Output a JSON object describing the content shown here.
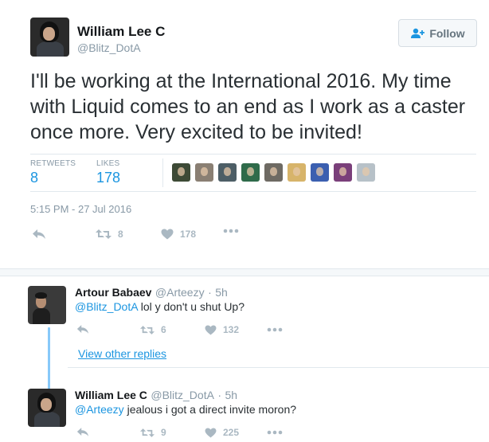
{
  "main_tweet": {
    "author_name": "William Lee C",
    "author_handle": "@Blitz_DotA",
    "follow_label": "Follow",
    "text": "I'll be working at the International 2016. My time with Liquid comes to an end as I work as a caster once more. Very excited to be invited!",
    "retweets_label": "RETWEETS",
    "retweets_count": "8",
    "likes_label": "LIKES",
    "likes_count": "178",
    "timestamp": "5:15 PM - 27 Jul 2016",
    "actions": {
      "retweet_count": "8",
      "like_count": "178"
    }
  },
  "likers": [
    {
      "color": "#3d4a36"
    },
    {
      "color": "#8a7f73"
    },
    {
      "color": "#4d5e66"
    },
    {
      "color": "#2f6b4a"
    },
    {
      "color": "#6e6a63"
    },
    {
      "color": "#d7b46a"
    },
    {
      "color": "#3b5fb0"
    },
    {
      "color": "#7a3f7a"
    },
    {
      "color": "#b7c1c8"
    }
  ],
  "replies": [
    {
      "author_name": "Artour Babaev",
      "author_handle": "@Arteezy",
      "time": "5h",
      "mention": "@Blitz_DotA",
      "text": " lol y don't u shut Up?",
      "retweet_count": "6",
      "like_count": "132"
    },
    {
      "author_name": "William Lee C",
      "author_handle": "@Blitz_DotA",
      "time": "5h",
      "mention": "@Arteezy",
      "text": " jealous i got a direct invite moron?",
      "retweet_count": "9",
      "like_count": "225"
    }
  ],
  "view_other_replies": "View other replies",
  "separator": "·",
  "colors": {
    "link_blue": "#1b95e0",
    "icon_gray": "#aab8c2",
    "thread_line": "#88c9f9"
  }
}
